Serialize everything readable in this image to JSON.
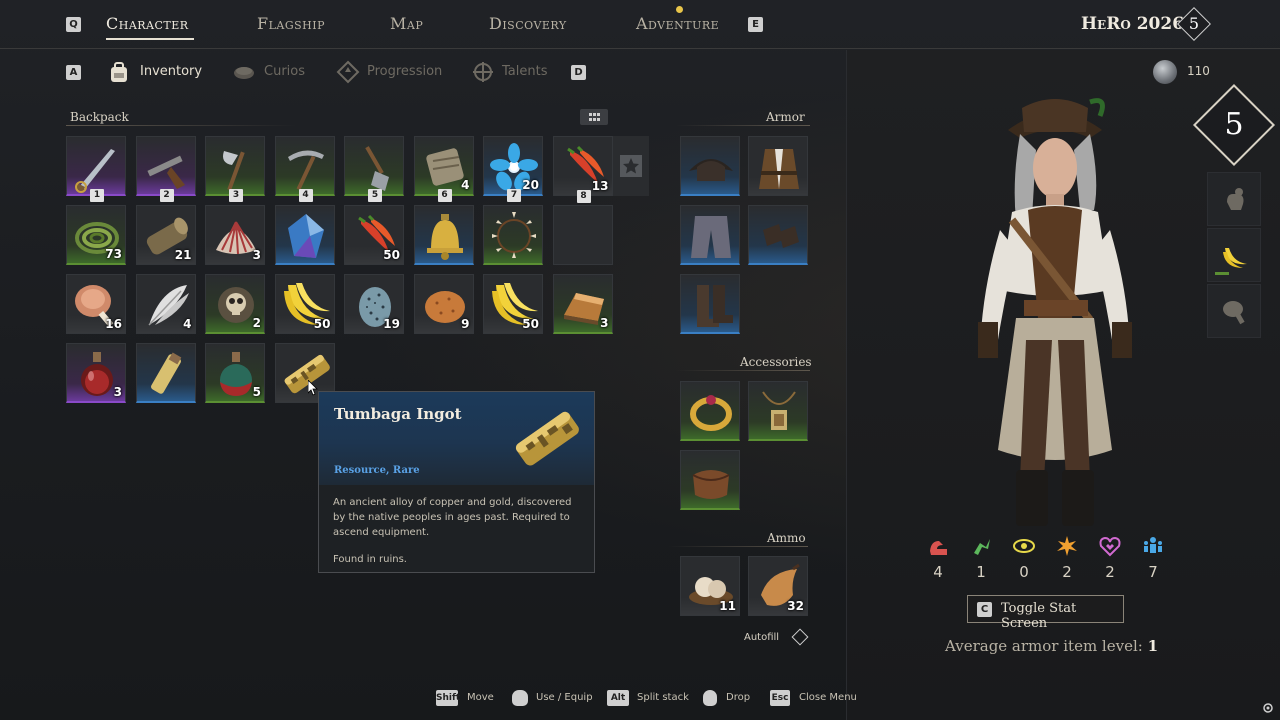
{
  "nav": {
    "left_key": "Q",
    "right_key": "E",
    "tabs": [
      {
        "label": "Character",
        "active": true
      },
      {
        "label": "Flagship",
        "active": false
      },
      {
        "label": "Map",
        "active": false
      },
      {
        "label": "Discovery",
        "active": false
      },
      {
        "label": "Adventure",
        "active": false
      }
    ],
    "hero_name": "HeRo 2026",
    "hero_level": "5"
  },
  "subtabs": {
    "left_key": "A",
    "right_key": "D",
    "items": [
      {
        "label": "Inventory",
        "icon": "backpack-icon",
        "active": true
      },
      {
        "label": "Curios",
        "icon": "curios-icon",
        "active": false
      },
      {
        "label": "Progression",
        "icon": "progression-icon",
        "active": false
      },
      {
        "label": "Talents",
        "icon": "talents-icon",
        "active": false
      }
    ]
  },
  "currency": {
    "amount": "110",
    "icon": "coin-icon"
  },
  "backpack": {
    "title": "Backpack",
    "items": [
      {
        "icon": "cutlass-icon",
        "rarity": "epic",
        "qty": "",
        "hotkey": "1"
      },
      {
        "icon": "flintlock-pistol-icon",
        "rarity": "epic",
        "qty": "",
        "hotkey": "2"
      },
      {
        "icon": "axe-icon",
        "rarity": "uncommon",
        "qty": "",
        "hotkey": "3"
      },
      {
        "icon": "pickaxe-icon",
        "rarity": "uncommon",
        "qty": "",
        "hotkey": "4"
      },
      {
        "icon": "shovel-icon",
        "rarity": "uncommon",
        "qty": "",
        "hotkey": "5"
      },
      {
        "icon": "bandage-icon",
        "rarity": "uncommon",
        "qty": "4",
        "hotkey": "6"
      },
      {
        "icon": "blue-flower-icon",
        "rarity": "rare",
        "qty": "20",
        "hotkey": "7"
      },
      {
        "icon": "chili-pepper-icon",
        "rarity": "common",
        "qty": "13",
        "hotkey": "8"
      },
      {
        "icon": "vine-rope-icon",
        "rarity": "uncommon",
        "qty": "73",
        "hotkey": ""
      },
      {
        "icon": "wood-log-icon",
        "rarity": "common",
        "qty": "21",
        "hotkey": ""
      },
      {
        "icon": "seashell-icon",
        "rarity": "common",
        "qty": "3",
        "hotkey": ""
      },
      {
        "icon": "crystal-icon",
        "rarity": "rare",
        "qty": "",
        "hotkey": ""
      },
      {
        "icon": "chili-pepper-icon",
        "rarity": "common",
        "qty": "50",
        "hotkey": ""
      },
      {
        "icon": "bell-icon",
        "rarity": "rare",
        "qty": "",
        "hotkey": ""
      },
      {
        "icon": "tooth-necklace-icon",
        "rarity": "uncommon",
        "qty": "",
        "hotkey": ""
      },
      {
        "icon": "empty",
        "rarity": "empty",
        "qty": "",
        "hotkey": ""
      },
      {
        "icon": "meat-drumstick-icon",
        "rarity": "common",
        "qty": "16",
        "hotkey": ""
      },
      {
        "icon": "feather-icon",
        "rarity": "common",
        "qty": "4",
        "hotkey": ""
      },
      {
        "icon": "skull-emblem-icon",
        "rarity": "uncommon",
        "qty": "2",
        "hotkey": ""
      },
      {
        "icon": "banana-icon",
        "rarity": "common",
        "qty": "50",
        "hotkey": ""
      },
      {
        "icon": "speckled-egg-icon",
        "rarity": "common",
        "qty": "19",
        "hotkey": ""
      },
      {
        "icon": "potato-icon",
        "rarity": "common",
        "qty": "9",
        "hotkey": ""
      },
      {
        "icon": "banana-icon",
        "rarity": "common",
        "qty": "50",
        "hotkey": ""
      },
      {
        "icon": "ingot-icon",
        "rarity": "uncommon",
        "qty": "3",
        "hotkey": ""
      },
      {
        "icon": "red-potion-icon",
        "rarity": "epic",
        "qty": "3",
        "hotkey": ""
      },
      {
        "icon": "vial-icon",
        "rarity": "rare",
        "qty": "",
        "hotkey": ""
      },
      {
        "icon": "green-potion-icon",
        "rarity": "uncommon",
        "qty": "5",
        "hotkey": ""
      },
      {
        "icon": "tumbaga-ingot-icon",
        "rarity": "common",
        "qty": "",
        "hotkey": ""
      }
    ]
  },
  "armor": {
    "title": "Armor",
    "slots": [
      {
        "icon": "tricorn-hat-icon",
        "rarity": "rare"
      },
      {
        "icon": "leather-vest-icon",
        "rarity": "common"
      },
      {
        "icon": "trousers-icon",
        "rarity": "rare"
      },
      {
        "icon": "gloves-icon",
        "rarity": "rare"
      },
      {
        "icon": "boots-icon",
        "rarity": "rare"
      }
    ]
  },
  "accessories": {
    "title": "Accessories",
    "slots": [
      {
        "icon": "gold-ring-icon",
        "rarity": "uncommon"
      },
      {
        "icon": "amulet-icon",
        "rarity": "uncommon"
      },
      {
        "icon": "leather-pouch-icon",
        "rarity": "uncommon"
      }
    ]
  },
  "ammo": {
    "title": "Ammo",
    "slots": [
      {
        "icon": "pearl-shot-icon",
        "rarity": "common",
        "qty": "11"
      },
      {
        "icon": "powder-horn-icon",
        "rarity": "common",
        "qty": "32"
      }
    ],
    "autofill_label": "Autofill"
  },
  "tooltip": {
    "name": "Tumbaga Ingot",
    "type": "Resource, Rare",
    "description": "An ancient alloy of copper and gold, discovered by the native peoples in ages past. Required to ascend equipment.",
    "found": "Found in ruins.",
    "icon": "tumbaga-ingot-icon"
  },
  "stats": [
    {
      "icon": "strength-arm-icon",
      "value": "4",
      "color": "#d9534f"
    },
    {
      "icon": "agility-icon",
      "value": "1",
      "color": "#5cb85c"
    },
    {
      "icon": "perception-eye-icon",
      "value": "0",
      "color": "#e6d84a"
    },
    {
      "icon": "burst-icon",
      "value": "2",
      "color": "#f0a030"
    },
    {
      "icon": "heart-icon",
      "value": "2",
      "color": "#d16ad1"
    },
    {
      "icon": "social-people-icon",
      "value": "7",
      "color": "#4aa8e6"
    }
  ],
  "toggle_stat": {
    "key": "C",
    "label": "Toggle Stat Screen"
  },
  "avg_armor": {
    "label": "Average armor item level:",
    "value": "1"
  },
  "side": {
    "level": "5"
  },
  "hints": [
    {
      "key": "Shift",
      "label": "Move"
    },
    {
      "key": "mouse-left",
      "label": "Use / Equip"
    },
    {
      "key": "Alt",
      "label": "Split stack"
    },
    {
      "key": "mouse-right",
      "label": "Drop"
    },
    {
      "key": "Esc",
      "label": "Close Menu"
    }
  ]
}
